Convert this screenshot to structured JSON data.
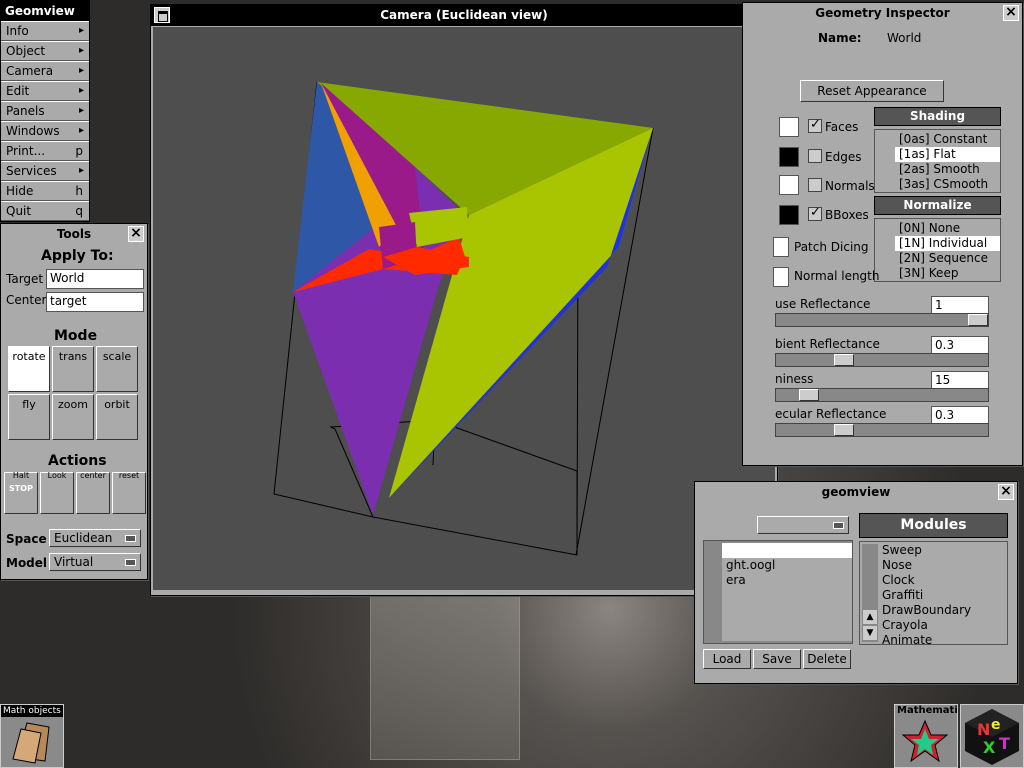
{
  "main_menu": {
    "title": "Geomview",
    "items": [
      {
        "label": "Info",
        "key": ""
      },
      {
        "label": "Object",
        "key": ""
      },
      {
        "label": "Camera",
        "key": ""
      },
      {
        "label": "Edit",
        "key": ""
      },
      {
        "label": "Panels",
        "key": ""
      },
      {
        "label": "Windows",
        "key": ""
      },
      {
        "label": "Print...",
        "key": "p"
      },
      {
        "label": "Services",
        "key": ""
      },
      {
        "label": "Hide",
        "key": "h"
      },
      {
        "label": "Quit",
        "key": "q"
      }
    ]
  },
  "tools": {
    "title": "Tools",
    "apply_to": "Apply To:",
    "target_label": "Target",
    "target_value": "World",
    "center_label": "Center",
    "center_value": "target",
    "mode_heading": "Mode",
    "modes": [
      "rotate",
      "trans",
      "scale",
      "fly",
      "zoom",
      "orbit"
    ],
    "actions_heading": "Actions",
    "actions": [
      "Halt",
      "Look",
      "center",
      "reset"
    ],
    "stop_text": "STOP",
    "space_label": "Space",
    "space_value": "Euclidean",
    "model_label": "Model",
    "model_value": "Virtual"
  },
  "camera": {
    "title": "Camera (Euclidean view)"
  },
  "inspector": {
    "title": "Geometry Inspector",
    "name_label": "Name:",
    "name_value": "World",
    "reset_button": "Reset Appearance",
    "shading_heading": "Shading",
    "shading_options": [
      "[0as] Constant",
      "[1as] Flat",
      "[2as] Smooth",
      "[3as] CSmooth"
    ],
    "shading_selected": 1,
    "normalize_heading": "Normalize",
    "normalize_options": [
      "[0N] None",
      "[1N] Individual",
      "[2N] Sequence",
      "[3N] Keep"
    ],
    "normalize_selected": 1,
    "checks": [
      {
        "label": "Faces",
        "checked": true
      },
      {
        "label": "Edges",
        "checked": false
      },
      {
        "label": "Normals",
        "checked": false
      },
      {
        "label": "BBoxes",
        "checked": true
      }
    ],
    "patch_dicing": "Patch Dicing",
    "normal_length": "Normal length",
    "sliders": [
      {
        "label": "use Reflectance",
        "value": "1",
        "level": 1.0
      },
      {
        "label": "bient Reflectance",
        "value": "0.3",
        "level": 0.3
      },
      {
        "label": "niness",
        "value": "15",
        "level": 0.12
      },
      {
        "label": "ecular Reflectance",
        "value": "0.3",
        "level": 0.3
      }
    ]
  },
  "geomview_panel": {
    "title": "geomview",
    "objects": [
      "",
      "ght.oogl",
      "era"
    ],
    "modules_heading": "Modules",
    "modules": [
      "Sweep",
      "Nose",
      "Clock",
      "Graffiti",
      "DrawBoundary",
      "Crayola",
      "Animate"
    ],
    "load": "Load",
    "save": "Save",
    "delete": "Delete"
  },
  "dock": {
    "math_objects": "Math objects",
    "mathematica": "Mathemati"
  },
  "colors": {
    "purple": "#7b2fb0",
    "yellowgreen": "#a9c400",
    "olive": "#86a800",
    "blue": "#2233dd",
    "steelblue": "#2f57a8",
    "red": "#ff2a00",
    "magenta": "#9a1a8a",
    "viewport": "#4e4e4e"
  }
}
